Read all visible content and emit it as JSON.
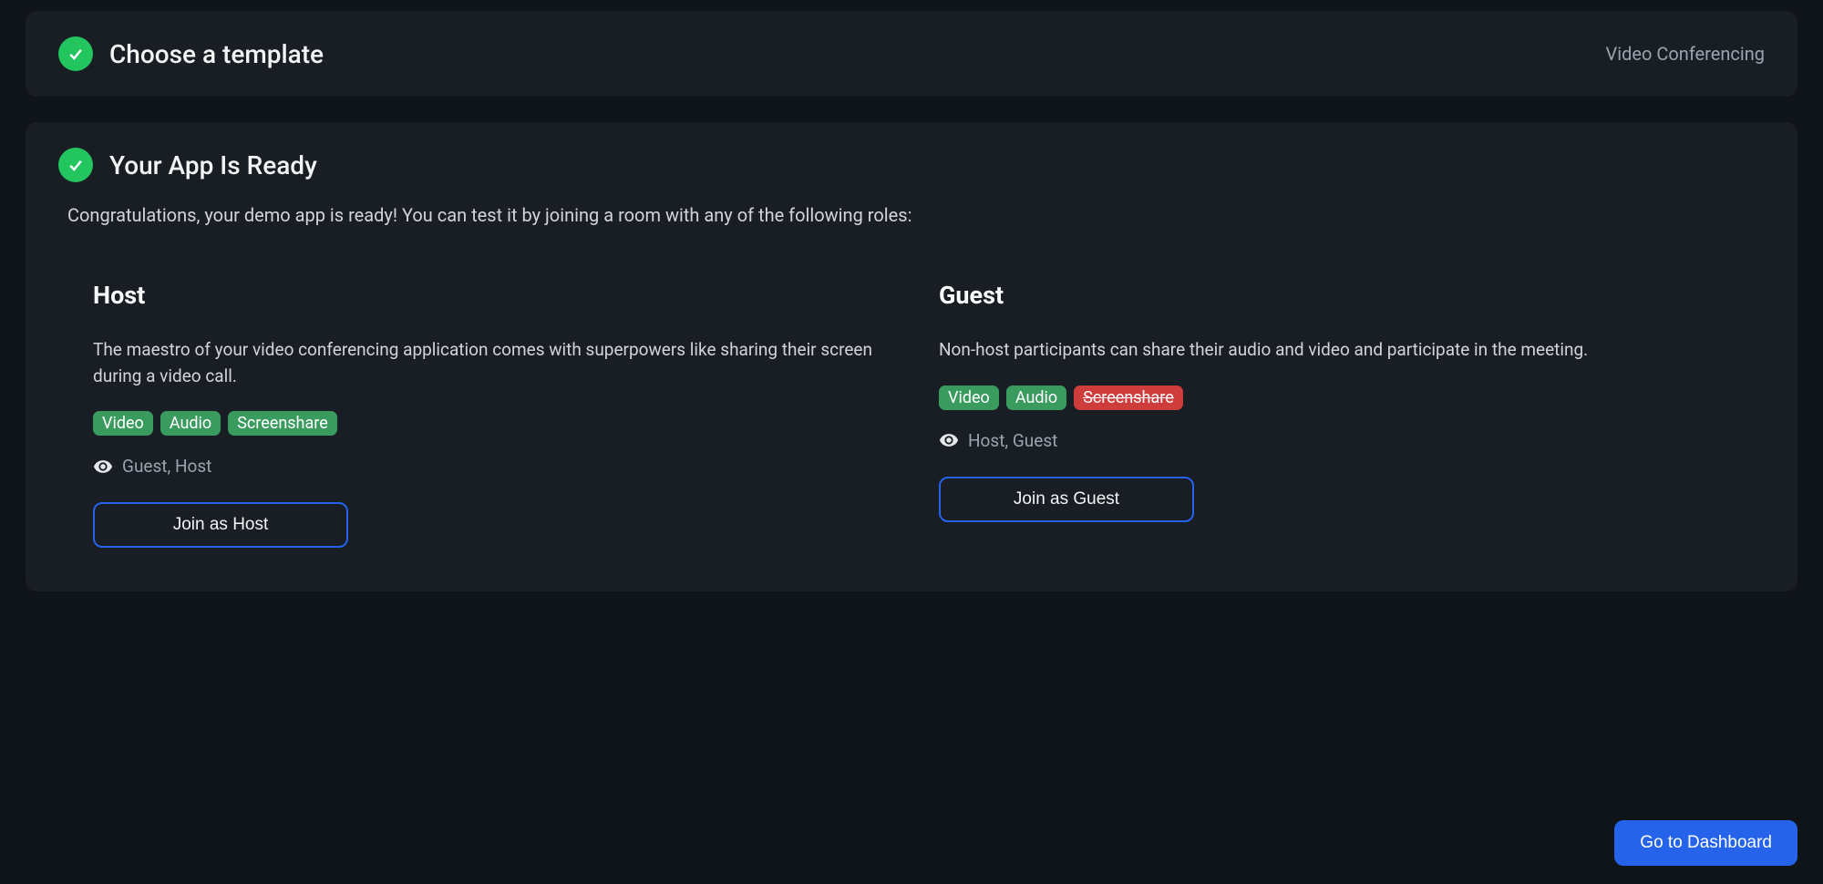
{
  "step1": {
    "title": "Choose a template",
    "selected": "Video Conferencing"
  },
  "step2": {
    "title": "Your App Is Ready",
    "congrats": "Congratulations, your demo app is ready! You can test it by joining a room with any of the following roles:"
  },
  "roles": {
    "host": {
      "title": "Host",
      "description": "The maestro of your video conferencing application comes with superpowers like sharing their screen during a video call.",
      "tags": [
        {
          "label": "Video",
          "type": "green"
        },
        {
          "label": "Audio",
          "type": "green"
        },
        {
          "label": "Screenshare",
          "type": "green"
        }
      ],
      "visibility": "Guest, Host",
      "button": "Join as Host"
    },
    "guest": {
      "title": "Guest",
      "description": "Non-host participants can share their audio and video and participate in the meeting.",
      "tags": [
        {
          "label": "Video",
          "type": "green"
        },
        {
          "label": "Audio",
          "type": "green"
        },
        {
          "label": "Screenshare",
          "type": "red"
        }
      ],
      "visibility": "Host, Guest",
      "button": "Join as Guest"
    }
  },
  "dashboard_button": "Go to Dashboard"
}
